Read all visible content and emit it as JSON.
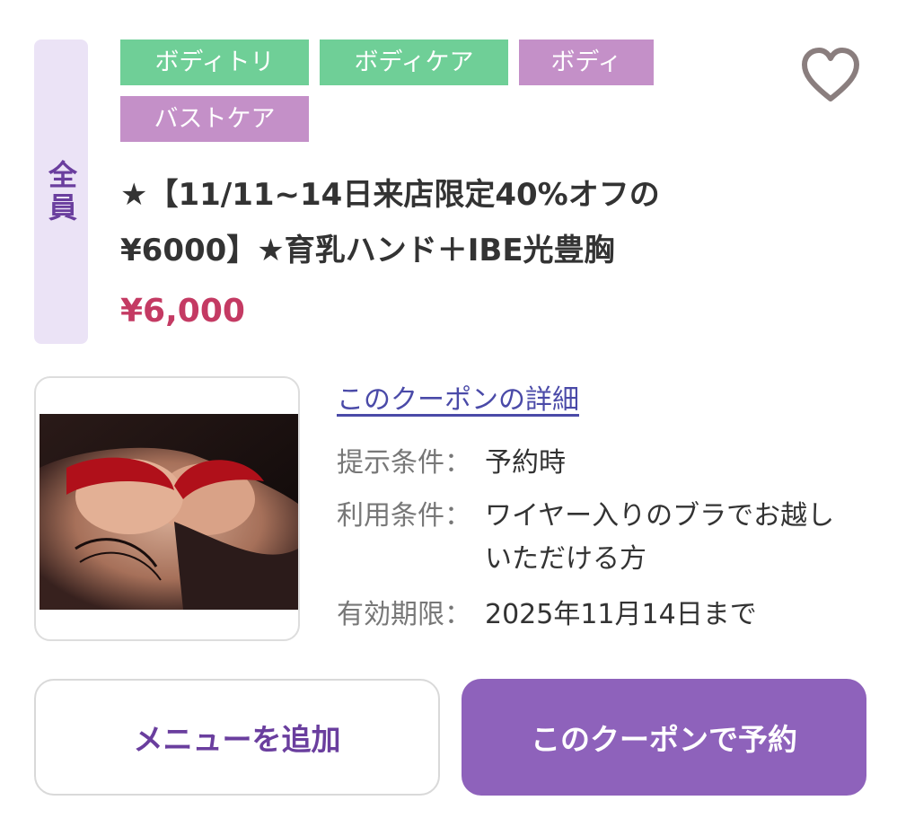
{
  "target": {
    "label": "全員"
  },
  "tags": [
    {
      "label": "ボディトリ",
      "color": "#6fcf97"
    },
    {
      "label": "ボディケア",
      "color": "#6fcf97"
    },
    {
      "label": "ボディ",
      "color": "#c490c8"
    },
    {
      "label": "バストケア",
      "color": "#c490c8"
    }
  ],
  "favorite": {
    "icon": "heart-outline-icon"
  },
  "coupon": {
    "title_line1": "★【11/11~14日来店限定40%オフの",
    "title_line2": "¥6000】★育乳ハンド＋IBE光豊胸",
    "price": "¥6,000",
    "detail_link": "このクーポンの詳細",
    "conditions": [
      {
        "label": "提示条件：",
        "value": "予約時"
      },
      {
        "label": "利用条件：",
        "value": "ワイヤー入りのブラでお越しいただける方"
      },
      {
        "label": "有効期限：",
        "value": "2025年11月14日まで"
      }
    ]
  },
  "buttons": {
    "add_menu": "メニューを追加",
    "reserve": "このクーポンで予約"
  },
  "colors": {
    "accent": "#8e62bb",
    "price": "#c43a63",
    "badge_bg": "#ebe3f6"
  }
}
